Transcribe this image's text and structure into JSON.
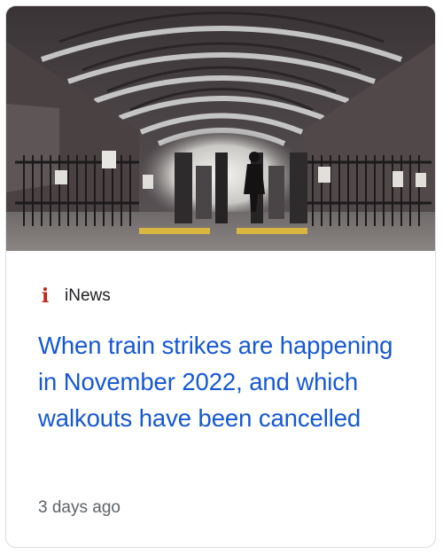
{
  "card": {
    "source": {
      "name": "iNews",
      "logo_glyph": "i",
      "logo_color": "#c8261b"
    },
    "headline": "When train strikes are happening in November 2022, and which walkouts have been cancelled",
    "age": "3 days ago",
    "image_icon": "train-station-photo",
    "colors": {
      "headline": "#1558d6",
      "meta": "#5f6368",
      "border": "#dadce0"
    }
  }
}
